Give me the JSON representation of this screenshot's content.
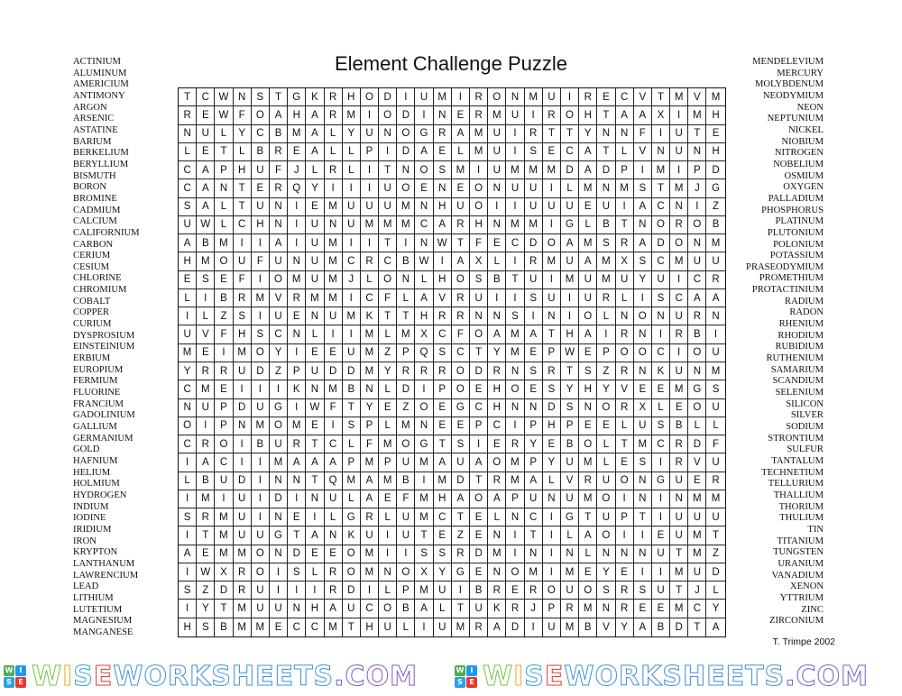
{
  "title": "Element Challenge Puzzle",
  "credit": "T. Trimpe 2002",
  "word_list_left": [
    "ACTINIUM",
    "ALUMINUM",
    "AMERICIUM",
    "ANTIMONY",
    "ARGON",
    "ARSENIC",
    "ASTATINE",
    "BARIUM",
    "BERKELIUM",
    "BERYLLIUM",
    "BISMUTH",
    "BORON",
    "BROMINE",
    "CADMIUM",
    "CALCIUM",
    "CALIFORNIUM",
    "CARBON",
    "CERIUM",
    "CESIUM",
    "CHLORINE",
    "CHROMIUM",
    "COBALT",
    "COPPER",
    "CURIUM",
    "DYSPROSIUM",
    "EINSTEINIUM",
    "ERBIUM",
    "EUROPIUM",
    "FERMIUM",
    "FLUORINE",
    "FRANCIUM",
    "GADOLINIUM",
    "GALLIUM",
    "GERMANIUM",
    "GOLD",
    "HAFNIUM",
    "HELIUM",
    "HOLMIUM",
    "HYDROGEN",
    "INDIUM",
    "IODINE",
    "IRIDIUM",
    "IRON",
    "KRYPTON",
    "LANTHANUM",
    "LAWRENCIUM",
    "LEAD",
    "LITHIUM",
    "LUTETIUM",
    "MAGNESIUM",
    "MANGANESE"
  ],
  "word_list_right": [
    "MENDELEVIUM",
    "MERCURY",
    "MOLYBDENUM",
    "NEODYMIUM",
    "NEON",
    "NEPTUNIUM",
    "NICKEL",
    "NIOBIUM",
    "NITROGEN",
    "NOBELIUM",
    "OSMIUM",
    "OXYGEN",
    "PALLADIUM",
    "PHOSPHORUS",
    "PLATINUM",
    "PLUTONIUM",
    "POLONIUM",
    "POTASSIUM",
    "PRASEODYMIUM",
    "PROMETHIUM",
    "PROTACTINIUM",
    "RADIUM",
    "RADON",
    "RHENIUM",
    "RHODIUM",
    "RUBIDIUM",
    "RUTHENIUM",
    "SAMARIUM",
    "SCANDIUM",
    "SELENIUM",
    "SILICON",
    "SILVER",
    "SODIUM",
    "STRONTIUM",
    "SULFUR",
    "TANTALUM",
    "TECHNETIUM",
    "TELLURIUM",
    "THALLIUM",
    "THORIUM",
    "THULIUM",
    "TIN",
    "TITANIUM",
    "TUNGSTEN",
    "URANIUM",
    "VANADIUM",
    "XENON",
    "YTTRIUM",
    "ZINC",
    "ZIRCONIUM"
  ],
  "grid_rows": [
    "TCWNSTGKRHODIUMIRONMUIRECVTMVM",
    "REWFOAHARMIODINERMUIROHTAAXIMH",
    "NULYCBMALYUNOGRAMUIRTTYNNFIUTE",
    "LETLBREALLPIDAELMUISECATLVNUNH",
    "CAPHUFJLRLITNOSMIUMMMDADPIMIPD",
    "CANTERQYIIIUOENEONUUILMNMSTMJG",
    "SALTUNIEMUUUMNHUOIIUUUEUIACNIZ",
    "UWLCHNIUNUMMMCARHNMMIGLBTNOROB",
    "ABMIIAIUMIITINWTFECDOAMSRADONM",
    "HMOUFUNUMCRCBWIAXLIRMUAMXSCMUU",
    "ESEFIOMUMJLONLHOSBTUIMUMUYUICR",
    "LIBRMVRMMICFLAVRUIISUIURLISCAA",
    "ILZSIUENUMKTTHRRNNSINIOLNONURN",
    "UVFHSCNLIIMLMXCFOAMATHAIRNIRBI",
    "MEIMOYIEEUMZPQSCTYMEPWEPOOCIOU",
    "YRRUDZPUDDMYRRRODRNSRTSZRNKUNM",
    "CMEIIIKNMBNLDIPOEHOESYHYVEEMGS",
    "NUPDUGIWFTYEZOEGCHNNDSNORXLEOU",
    "OIPNMOMEISPLMNEEPCIPHPEELUSBLL",
    "CROIBURTCLFMOGTSIERYEBOLTMCRDF",
    "IACIIMAAAPMPUMAUAOMPYUMLESIRVU",
    "LBUDINNTQMAMBIMDTRMALVRUONGUER",
    "IMIUIDINULAEFMHAOAPUNUMOININMM",
    "SRMUINEILGRLUMCTELNCIGTUPTIUUU",
    "ITMUUGTANKUIUTEZENITILAOIIEUMT",
    "AEMMONDEEOMIISSRDMININLNNNUTMZ",
    "IWXROISLROMNOXYGENOMIMEYEIIMUD",
    "SZDRUIIIRDILPMUIBREROUOSRSUTJL",
    "IYTMUUNHAUCOBALTUKRJPRMNREEMCY",
    "HSBMMECCMTHULIUMRADIUMBVYABDTA"
  ],
  "watermark": {
    "logo_letters": [
      "W",
      "I",
      "S",
      "E"
    ],
    "logo_colors": [
      "#4caf50",
      "#2196f3",
      "#29a3e0",
      "#e53935"
    ],
    "text": "WISEWORKSHEETS.COM",
    "letter_colors": [
      "#7cc242",
      "#f5a623",
      "#29a3e0",
      "#e53935",
      "#3f8fd8",
      "#3f8fd8",
      "#3f8fd8",
      "#3f8fd8",
      "#3f8fd8",
      "#3f8fd8",
      "#3f8fd8",
      "#3f8fd8",
      "#3f8fd8",
      "#3f8fd8",
      "#7a5cc8",
      "#7a5cc8",
      "#7a5cc8",
      "#7a5cc8"
    ]
  }
}
